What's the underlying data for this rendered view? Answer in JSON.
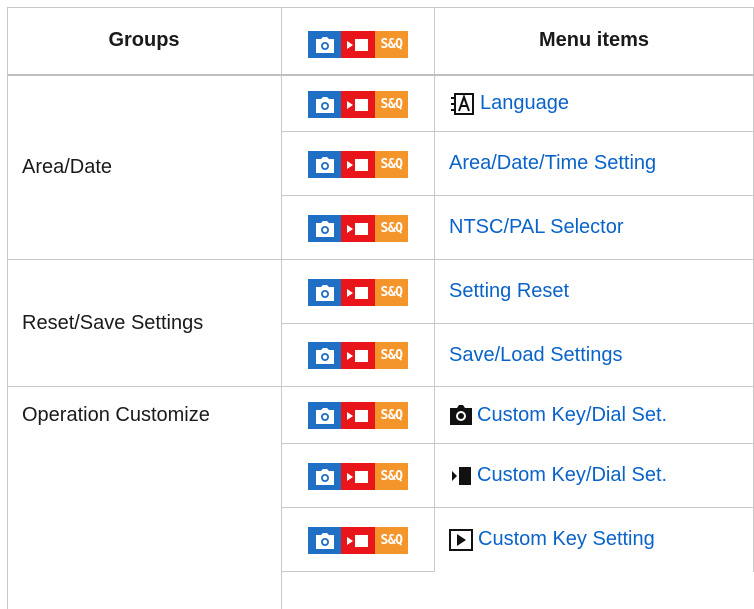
{
  "header": {
    "groups_label": "Groups",
    "menu_items_label": "Menu items",
    "mode_icons": [
      "photo-mode",
      "movie-mode",
      "s-and-q-mode"
    ],
    "sq_label": "S&Q"
  },
  "groups": [
    {
      "label": "Area/Date"
    },
    {
      "label": "Reset/Save Settings"
    },
    {
      "label": "Operation Customize"
    }
  ],
  "rows": [
    {
      "group": 0,
      "menu_label": "Language",
      "prefix_icon": "language-icon"
    },
    {
      "group": 0,
      "menu_label": "Area/Date/Time Setting",
      "prefix_icon": ""
    },
    {
      "group": 0,
      "menu_label": "NTSC/PAL Selector",
      "prefix_icon": ""
    },
    {
      "group": 1,
      "menu_label": "Setting Reset",
      "prefix_icon": ""
    },
    {
      "group": 1,
      "menu_label": "Save/Load Settings",
      "prefix_icon": ""
    },
    {
      "group": 2,
      "menu_label": "Custom Key/Dial Set.",
      "prefix_icon": "camera-icon"
    },
    {
      "group": 2,
      "menu_label": "Custom Key/Dial Set.",
      "prefix_icon": "movie-icon"
    },
    {
      "group": 2,
      "menu_label": "Custom Key Setting",
      "prefix_icon": "play-icon"
    }
  ],
  "colors": {
    "link": "#0a63c9",
    "photo_mode": "#1f6fc4",
    "movie_mode": "#e8161b",
    "sq_mode": "#f3952a",
    "grid": "#c8c8c8"
  }
}
